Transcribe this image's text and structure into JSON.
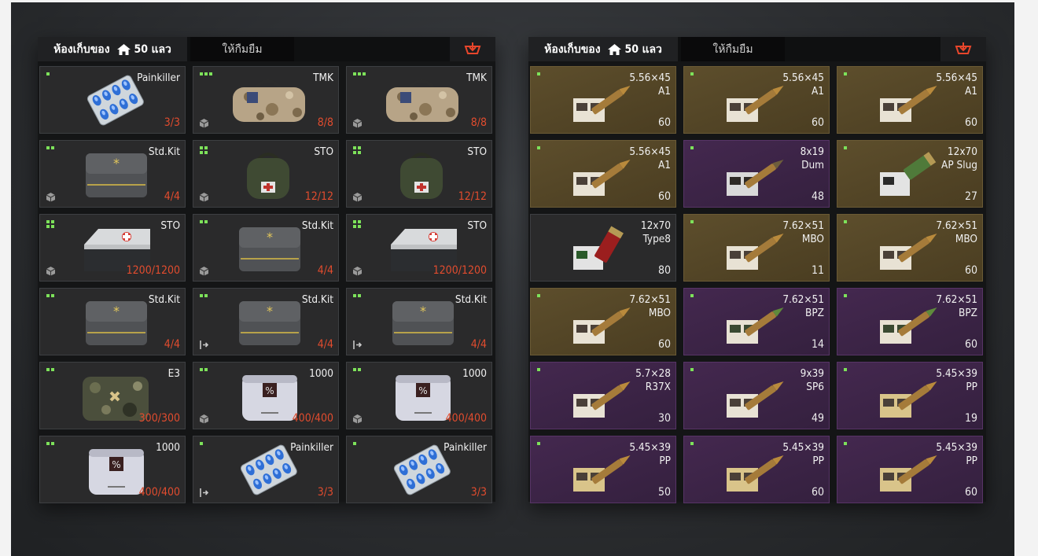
{
  "panels": [
    {
      "side": "left",
      "header": {
        "storage_label": "ห้องเก็บของ",
        "storage_count": "50 แลว",
        "borrow_label": "ให้กืมยืม"
      },
      "items": [
        {
          "name": "Painkiller",
          "count": "3/3",
          "level": 1,
          "icon": "pill-blister-pack-icon",
          "badge": "none",
          "bg": "dark"
        },
        {
          "name": "TMK",
          "count": "8/8",
          "level": 3,
          "icon": "camo-medical-bag-icon",
          "badge": "cube-icon",
          "bg": "dark"
        },
        {
          "name": "TMK",
          "count": "8/8",
          "level": 3,
          "icon": "camo-medical-bag-icon",
          "badge": "cube-icon",
          "bg": "dark"
        },
        {
          "name": "Std.Kit",
          "count": "4/4",
          "level": 2,
          "icon": "grey-medkit-pouch-icon",
          "badge": "cube-icon",
          "bg": "dark"
        },
        {
          "name": "STO",
          "count": "12/12",
          "level": 4,
          "icon": "green-medical-backpack-icon",
          "badge": "cube-icon",
          "bg": "dark"
        },
        {
          "name": "STO",
          "count": "12/12",
          "level": 4,
          "icon": "green-medical-backpack-icon",
          "badge": "cube-icon",
          "bg": "dark"
        },
        {
          "name": "STO",
          "count": "1200/1200",
          "level": 4,
          "icon": "medical-case-icon",
          "badge": "cube-icon",
          "bg": "dark"
        },
        {
          "name": "Std.Kit",
          "count": "4/4",
          "level": 2,
          "icon": "grey-medkit-pouch-icon",
          "badge": "cube-icon",
          "bg": "dark"
        },
        {
          "name": "STO",
          "count": "1200/1200",
          "level": 4,
          "icon": "medical-case-icon",
          "badge": "cube-icon",
          "bg": "dark"
        },
        {
          "name": "Std.Kit",
          "count": "4/4",
          "level": 2,
          "icon": "grey-medkit-pouch-icon",
          "badge": "none",
          "bg": "dark"
        },
        {
          "name": "Std.Kit",
          "count": "4/4",
          "level": 2,
          "icon": "grey-medkit-pouch-icon",
          "badge": "exit-icon",
          "bg": "dark"
        },
        {
          "name": "Std.Kit",
          "count": "4/4",
          "level": 2,
          "icon": "grey-medkit-pouch-icon",
          "badge": "exit-icon",
          "bg": "dark"
        },
        {
          "name": "E3",
          "count": "300/300",
          "level": 2,
          "icon": "camo-pouch-icon",
          "badge": "none",
          "bg": "dark"
        },
        {
          "name": "1000",
          "count": "400/400",
          "level": 2,
          "icon": "white-medkit-bag-icon",
          "badge": "cube-icon",
          "bg": "dark"
        },
        {
          "name": "1000",
          "count": "400/400",
          "level": 2,
          "icon": "white-medkit-bag-icon",
          "badge": "cube-icon",
          "bg": "dark"
        },
        {
          "name": "1000",
          "count": "400/400",
          "level": 2,
          "icon": "white-medkit-bag-icon",
          "badge": "none",
          "bg": "dark"
        },
        {
          "name": "Painkiller",
          "count": "3/3",
          "level": 1,
          "icon": "pill-blister-pack-icon",
          "badge": "exit-icon",
          "bg": "dark"
        },
        {
          "name": "Painkiller",
          "count": "3/3",
          "level": 1,
          "icon": "pill-blister-pack-icon",
          "badge": "none",
          "bg": "dark"
        }
      ]
    },
    {
      "side": "right",
      "header": {
        "storage_label": "ห้องเก็บของ",
        "storage_count": "50 แลว",
        "borrow_label": "ให้กืมยืม"
      },
      "items": [
        {
          "name": "5.56×45\nA1",
          "count": "60",
          "level": 1,
          "icon": "ammo-box-brass-icon",
          "badge": "none",
          "bg": "tan"
        },
        {
          "name": "5.56×45\nA1",
          "count": "60",
          "level": 1,
          "icon": "ammo-box-brass-icon",
          "badge": "none",
          "bg": "tan"
        },
        {
          "name": "5.56×45\nA1",
          "count": "60",
          "level": 1,
          "icon": "ammo-box-brass-icon",
          "badge": "none",
          "bg": "tan"
        },
        {
          "name": "5.56×45\nA1",
          "count": "60",
          "level": 1,
          "icon": "ammo-box-brass-icon",
          "badge": "none",
          "bg": "tan"
        },
        {
          "name": "8x19\nDum",
          "count": "48",
          "level": 1,
          "icon": "ammo-box-dark-icon",
          "badge": "none",
          "bg": "purple"
        },
        {
          "name": "12x70\nAP Slug",
          "count": "27",
          "level": 1,
          "icon": "shotgun-shell-box-green-icon",
          "badge": "none",
          "bg": "tan"
        },
        {
          "name": "12x70\nType8",
          "count": "80",
          "level": 0,
          "icon": "shotgun-shell-box-red-icon",
          "badge": "none",
          "bg": "dark"
        },
        {
          "name": "7.62×51\nMBO",
          "count": "11",
          "level": 1,
          "icon": "ammo-box-brass-icon",
          "badge": "none",
          "bg": "tan"
        },
        {
          "name": "7.62×51\nMBO",
          "count": "60",
          "level": 1,
          "icon": "ammo-box-brass-icon",
          "badge": "none",
          "bg": "tan"
        },
        {
          "name": "7.62×51\nMBO",
          "count": "60",
          "level": 1,
          "icon": "ammo-box-brass-icon",
          "badge": "none",
          "bg": "tan"
        },
        {
          "name": "7.62×51\nBPZ",
          "count": "14",
          "level": 1,
          "icon": "ammo-box-green-tip-icon",
          "badge": "none",
          "bg": "purple"
        },
        {
          "name": "7.62×51\nBPZ",
          "count": "60",
          "level": 1,
          "icon": "ammo-box-green-tip-icon",
          "badge": "none",
          "bg": "purple"
        },
        {
          "name": "5.7×28\nR37X",
          "count": "30",
          "level": 1,
          "icon": "ammo-box-brass-icon",
          "badge": "none",
          "bg": "purple"
        },
        {
          "name": "9x39\nSP6",
          "count": "49",
          "level": 1,
          "icon": "ammo-box-brass-icon",
          "badge": "none",
          "bg": "purple"
        },
        {
          "name": "5.45×39\nPP",
          "count": "19",
          "level": 1,
          "icon": "ammo-box-yellow-icon",
          "badge": "none",
          "bg": "purple"
        },
        {
          "name": "5.45×39\nPP",
          "count": "50",
          "level": 1,
          "icon": "ammo-box-yellow-icon",
          "badge": "none",
          "bg": "purple"
        },
        {
          "name": "5.45×39\nPP",
          "count": "60",
          "level": 1,
          "icon": "ammo-box-yellow-icon",
          "badge": "none",
          "bg": "purple"
        },
        {
          "name": "5.45×39\nPP",
          "count": "60",
          "level": 1,
          "icon": "ammo-box-yellow-icon",
          "badge": "none",
          "bg": "purple"
        }
      ]
    }
  ],
  "colors": {
    "accent_red": "#e24c2e",
    "level_green": "#7de25a",
    "tan_bg": "#5d4e2c",
    "purple_bg": "#44284f"
  }
}
